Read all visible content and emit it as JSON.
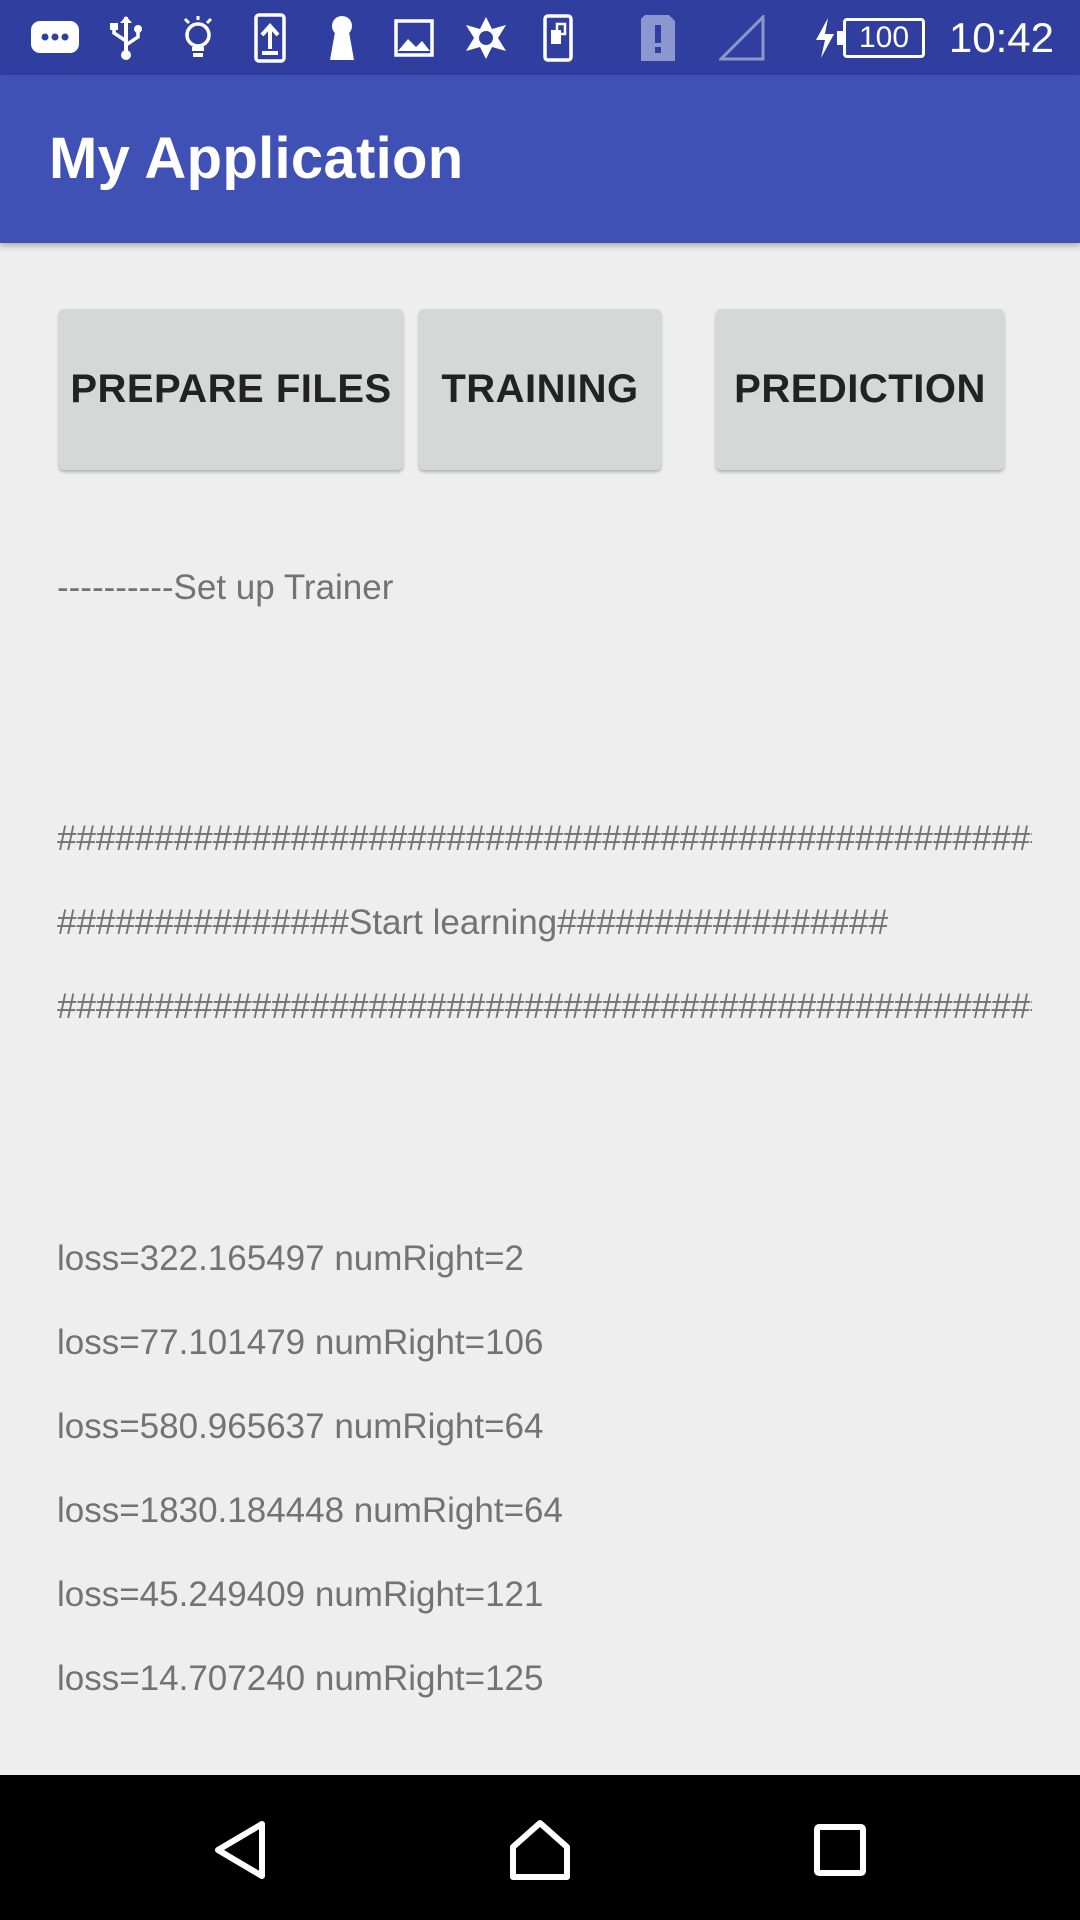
{
  "status_bar": {
    "battery_level": "100",
    "time": "10:42",
    "icons": [
      "messaging-icon",
      "usb-icon",
      "lightbulb-icon",
      "upload-icon",
      "keyhole-icon",
      "image-icon",
      "tools-icon",
      "sim-icon",
      "alert-icon",
      "signal-icon",
      "charging-icon",
      "battery-icon"
    ]
  },
  "app_bar": {
    "title": "My Application"
  },
  "buttons": {
    "prepare_files": "PREPARE FILES",
    "training": "TRAINING",
    "prediction": "PREDICTION"
  },
  "log": {
    "setup_line": "----------Set up Trainer",
    "hash_line_1": "##################################################################",
    "start_line": "###############Start learning#################",
    "hash_line_2": "##################################################################",
    "entries": [
      "loss=322.165497 numRight=2",
      "loss=77.101479 numRight=106",
      "loss=580.965637 numRight=64",
      "loss=1830.184448 numRight=64",
      "loss=45.249409 numRight=121",
      "loss=14.707240 numRight=125"
    ]
  },
  "colors": {
    "status_bar": "#303f9f",
    "app_bar": "#3f51b5",
    "background": "#eeeeee",
    "button": "#d6d7d7",
    "log_text": "#737373",
    "nav_bar": "#000000"
  }
}
